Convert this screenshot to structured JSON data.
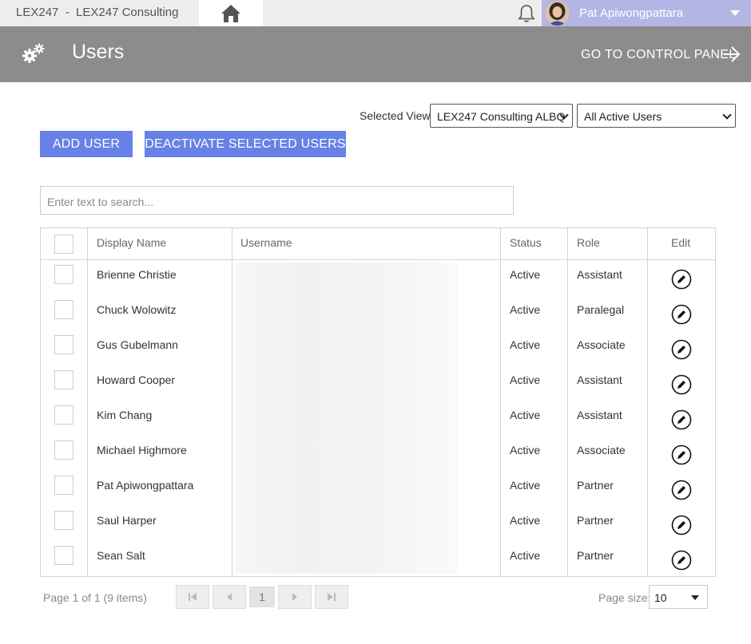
{
  "topbar": {
    "brand": "LEX247  -  LEX247 Consulting",
    "home_icon": "home-icon",
    "bell_icon": "bell-icon",
    "user_name": "Pat Apiwongpattara",
    "accent": "#b3b6e4"
  },
  "header": {
    "title": "Users",
    "control_panel": "GO TO CONTROL PANEL",
    "bg": "#8c8c8c"
  },
  "view": {
    "label": "Selected View:",
    "office": "LEX247 Consulting ALBQ",
    "filter": "All Active Users"
  },
  "buttons": {
    "add": "ADD USER",
    "deactivate": "DEACTIVATE SELECTED USERS",
    "color": "#6682e6"
  },
  "search": {
    "placeholder": "Enter text to search..."
  },
  "table": {
    "columns": [
      "Display Name",
      "Username",
      "Status",
      "Role",
      "Edit"
    ],
    "rows": [
      {
        "name": "Brienne Christie",
        "username": "",
        "status": "Active",
        "role": "Assistant"
      },
      {
        "name": "Chuck Wolowitz",
        "username": "",
        "status": "Active",
        "role": "Paralegal"
      },
      {
        "name": "Gus Gubelmann",
        "username": "",
        "status": "Active",
        "role": "Associate"
      },
      {
        "name": "Howard Cooper",
        "username": "",
        "status": "Active",
        "role": "Assistant"
      },
      {
        "name": "Kim Chang",
        "username": "",
        "status": "Active",
        "role": "Assistant"
      },
      {
        "name": "Michael Highmore",
        "username": "",
        "status": "Active",
        "role": "Associate"
      },
      {
        "name": "Pat Apiwongpattara",
        "username": "",
        "status": "Active",
        "role": "Partner"
      },
      {
        "name": "Saul Harper",
        "username": "",
        "status": "Active",
        "role": "Partner"
      },
      {
        "name": "Sean Salt",
        "username": "",
        "status": "Active",
        "role": "Partner"
      }
    ]
  },
  "pager": {
    "info": "Page 1 of 1 (9 items)",
    "current_page": "1",
    "page_size_label": "Page size:",
    "page_size": "10"
  }
}
